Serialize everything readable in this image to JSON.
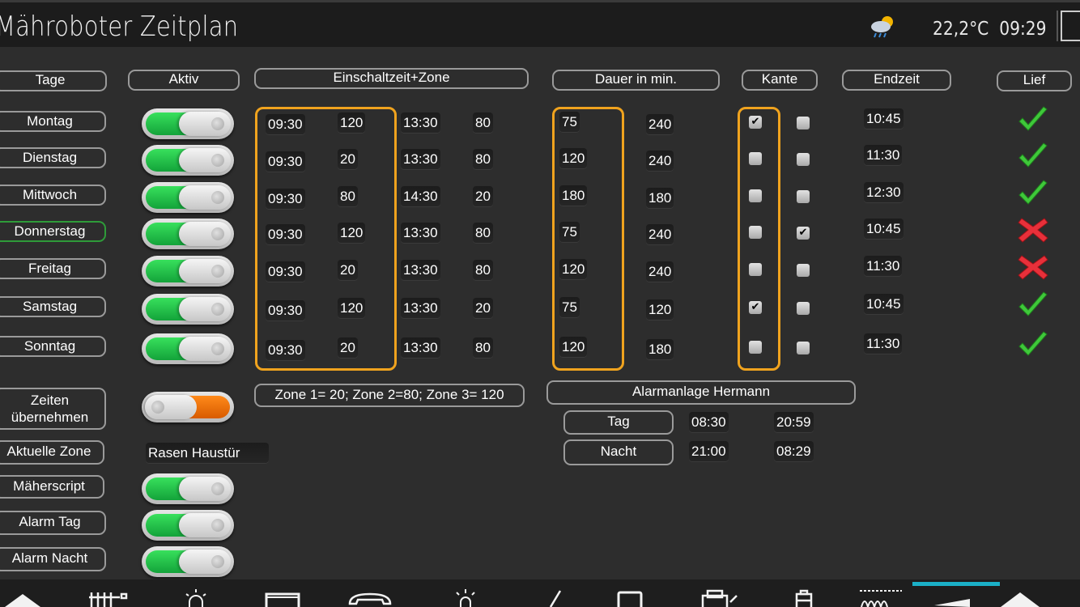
{
  "header": {
    "title": "Mähroboter Zeitplan",
    "temperature": "22,2°C",
    "time": "09:29",
    "weather_icon": "cloud-rain-sun-icon"
  },
  "columns": {
    "tage": "Tage",
    "aktiv": "Aktiv",
    "einschaltzeit": "Einschaltzeit+Zone",
    "dauer": "Dauer in min.",
    "kante": "Kante",
    "endzeit": "Endzeit",
    "lief": "Lief"
  },
  "days": [
    {
      "name": "Montag",
      "active": true,
      "start1": "09:30",
      "zone1": "120",
      "start2": "13:30",
      "zone2": "80",
      "dauer1": "75",
      "dauer2": "240",
      "kante1": true,
      "kante2": false,
      "endzeit": "10:45",
      "lief": "ok"
    },
    {
      "name": "Dienstag",
      "active": true,
      "start1": "09:30",
      "zone1": "20",
      "start2": "13:30",
      "zone2": "80",
      "dauer1": "120",
      "dauer2": "240",
      "kante1": false,
      "kante2": false,
      "endzeit": "11:30",
      "lief": "ok"
    },
    {
      "name": "Mittwoch",
      "active": true,
      "start1": "09:30",
      "zone1": "80",
      "start2": "14:30",
      "zone2": "20",
      "dauer1": "180",
      "dauer2": "180",
      "kante1": false,
      "kante2": false,
      "endzeit": "12:30",
      "lief": "ok"
    },
    {
      "name": "Donnerstag",
      "active": true,
      "start1": "09:30",
      "zone1": "120",
      "start2": "13:30",
      "zone2": "80",
      "dauer1": "75",
      "dauer2": "240",
      "kante1": false,
      "kante2": true,
      "endzeit": "10:45",
      "lief": "fail"
    },
    {
      "name": "Freitag",
      "active": true,
      "start1": "09:30",
      "zone1": "20",
      "start2": "13:30",
      "zone2": "80",
      "dauer1": "120",
      "dauer2": "240",
      "kante1": false,
      "kante2": false,
      "endzeit": "11:30",
      "lief": "fail"
    },
    {
      "name": "Samstag",
      "active": true,
      "start1": "09:30",
      "zone1": "120",
      "start2": "13:30",
      "zone2": "20",
      "dauer1": "75",
      "dauer2": "120",
      "kante1": true,
      "kante2": false,
      "endzeit": "10:45",
      "lief": "ok"
    },
    {
      "name": "Sonntag",
      "active": true,
      "start1": "09:30",
      "zone1": "20",
      "start2": "13:30",
      "zone2": "80",
      "dauer1": "120",
      "dauer2": "180",
      "kante1": false,
      "kante2": false,
      "endzeit": "11:30",
      "lief": "ok"
    }
  ],
  "zone_info": "Zone 1= 20; Zone 2=80; Zone 3= 120",
  "alarm": {
    "title": "Alarmanlage Hermann",
    "tag_label": "Tag",
    "tag_from": "08:30",
    "tag_to": "20:59",
    "nacht_label": "Nacht",
    "nacht_from": "21:00",
    "nacht_to": "08:29"
  },
  "controls": {
    "zeiten_uebernehmen": "Zeiten übernehmen",
    "zeiten_active": false,
    "aktuelle_zone_label": "Aktuelle Zone",
    "aktuelle_zone_value": "Rasen Haustür",
    "maeherscript": "Mäherscript",
    "maeherscript_active": true,
    "alarm_tag": "Alarm Tag",
    "alarm_tag_active": true,
    "alarm_nacht": "Alarm Nacht",
    "alarm_nacht_active": true
  },
  "colors": {
    "toggle_on": "#1fc24a",
    "toggle_off": "#e86a00",
    "highlight_box": "#f0a31e",
    "selected_border": "#2e9b39",
    "nav_indicator": "#1bb0c7"
  },
  "nav_icons": [
    "home-icon",
    "radiator-icon",
    "light-icon",
    "window-icon",
    "phone-icon",
    "lamp-icon",
    "pen-icon",
    "monitor-icon",
    "printer-icon",
    "battery-icon",
    "pool-icon",
    "vacuum-icon",
    "up-icon"
  ]
}
